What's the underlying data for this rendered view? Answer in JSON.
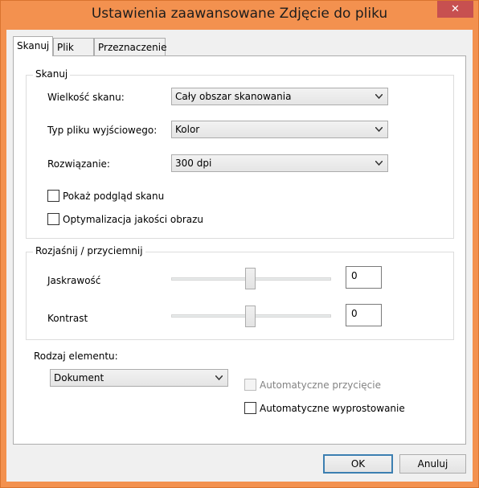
{
  "window": {
    "title": "Ustawienia zaawansowane Zdjęcie do pliku",
    "close_glyph": "✕"
  },
  "tabs": [
    {
      "label": "Skanuj",
      "active": true
    },
    {
      "label": "Plik",
      "active": false
    },
    {
      "label": "Przeznaczenie",
      "active": false
    }
  ],
  "scan_group": {
    "title": "Skanuj",
    "size_label": "Wielkość skanu:",
    "size_value": "Cały obszar skanowania",
    "filetype_label": "Typ pliku wyjściowego:",
    "filetype_value": "Kolor",
    "resolution_label": "Rozwiązanie:",
    "resolution_value": "300 dpi",
    "preview_label": "Pokaż podgląd skanu",
    "preview_checked": false,
    "optimize_label": "Optymalizacja jakości obrazu",
    "optimize_checked": false
  },
  "adjust_group": {
    "title": "Rozjaśnij / przyciemnij",
    "brightness_label": "Jaskrawość",
    "brightness_value": "0",
    "brightness_level": 0.5,
    "contrast_label": "Kontrast",
    "contrast_value": "0",
    "contrast_level": 0.5
  },
  "element": {
    "label": "Rodzaj elementu:",
    "value": "Dokument",
    "autocrop_label": "Automatyczne przycięcie",
    "autocrop_enabled": false,
    "deskew_label": "Automatyczne wyprostowanie",
    "deskew_checked": false
  },
  "buttons": {
    "ok": "OK",
    "cancel": "Anuluj"
  },
  "colors": {
    "title_bar": "#f3914f",
    "close_button": "#c75050",
    "default_button_border": "#3c7fb1"
  }
}
